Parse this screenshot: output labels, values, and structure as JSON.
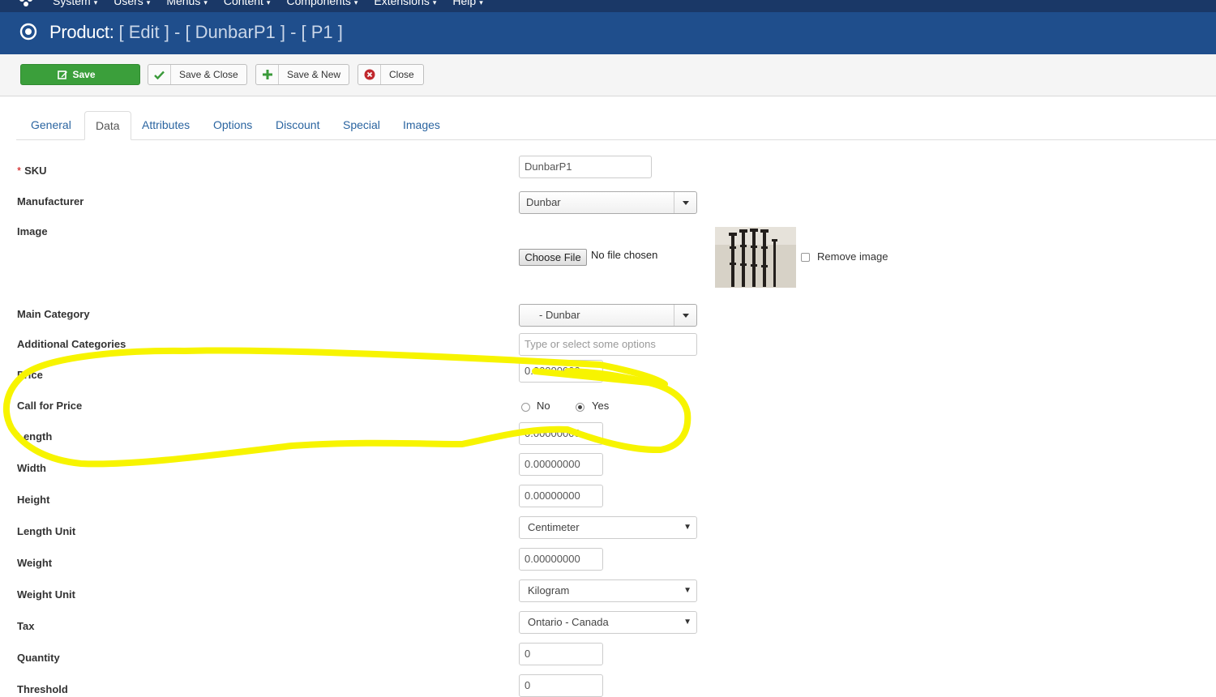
{
  "topnav": {
    "items": [
      {
        "label": "System"
      },
      {
        "label": "Users"
      },
      {
        "label": "Menus"
      },
      {
        "label": "Content"
      },
      {
        "label": "Components"
      },
      {
        "label": "Extensions"
      },
      {
        "label": "Help"
      }
    ]
  },
  "header": {
    "title_prefix": "Product:",
    "title_rest": "[ Edit ] - [ DunbarP1 ] - [ P1 ]"
  },
  "toolbar": {
    "save_label": "Save",
    "save_close_label": "Save & Close",
    "save_new_label": "Save & New",
    "close_label": "Close"
  },
  "tabs": [
    "General",
    "Data",
    "Attributes",
    "Options",
    "Discount",
    "Special",
    "Images"
  ],
  "active_tab": "Data",
  "form": {
    "sku": {
      "label": "SKU",
      "required_mark": "*",
      "value": "DunbarP1"
    },
    "manufacturer": {
      "label": "Manufacturer",
      "value": "Dunbar"
    },
    "image": {
      "label": "Image",
      "choose_file_label": "Choose File",
      "file_status": "No file chosen",
      "remove_label": "Remove image"
    },
    "main_category": {
      "label": "Main Category",
      "value": "- Dunbar"
    },
    "additional_categories": {
      "label": "Additional Categories",
      "placeholder": "Type or select some options"
    },
    "price": {
      "label": "Price",
      "value": "0.00000000"
    },
    "call_for_price": {
      "label": "Call for Price",
      "options": [
        "No",
        "Yes"
      ],
      "selected": "Yes"
    },
    "length": {
      "label": "Length",
      "value": "0.00000000"
    },
    "width": {
      "label": "Width",
      "value": "0.00000000"
    },
    "height": {
      "label": "Height",
      "value": "0.00000000"
    },
    "length_unit": {
      "label": "Length Unit",
      "value": "Centimeter"
    },
    "weight": {
      "label": "Weight",
      "value": "0.00000000"
    },
    "weight_unit": {
      "label": "Weight Unit",
      "value": "Kilogram"
    },
    "tax": {
      "label": "Tax",
      "value": "Ontario - Canada"
    },
    "quantity": {
      "label": "Quantity",
      "value": "0"
    },
    "threshold": {
      "label": "Threshold",
      "value": "0"
    }
  },
  "colors": {
    "topbar": "#1a3867",
    "header": "#1f4e8c",
    "save_button": "#3b9f3b",
    "tab_link": "#2a64a0",
    "highlight": "#f7f400"
  },
  "icons": {
    "joomla_logo": "joomla-logo",
    "header_icon": "target-circle-icon",
    "save": "edit-icon",
    "save_close": "checkmark-icon",
    "save_new": "plus-icon",
    "close": "cancel-circle-icon"
  }
}
